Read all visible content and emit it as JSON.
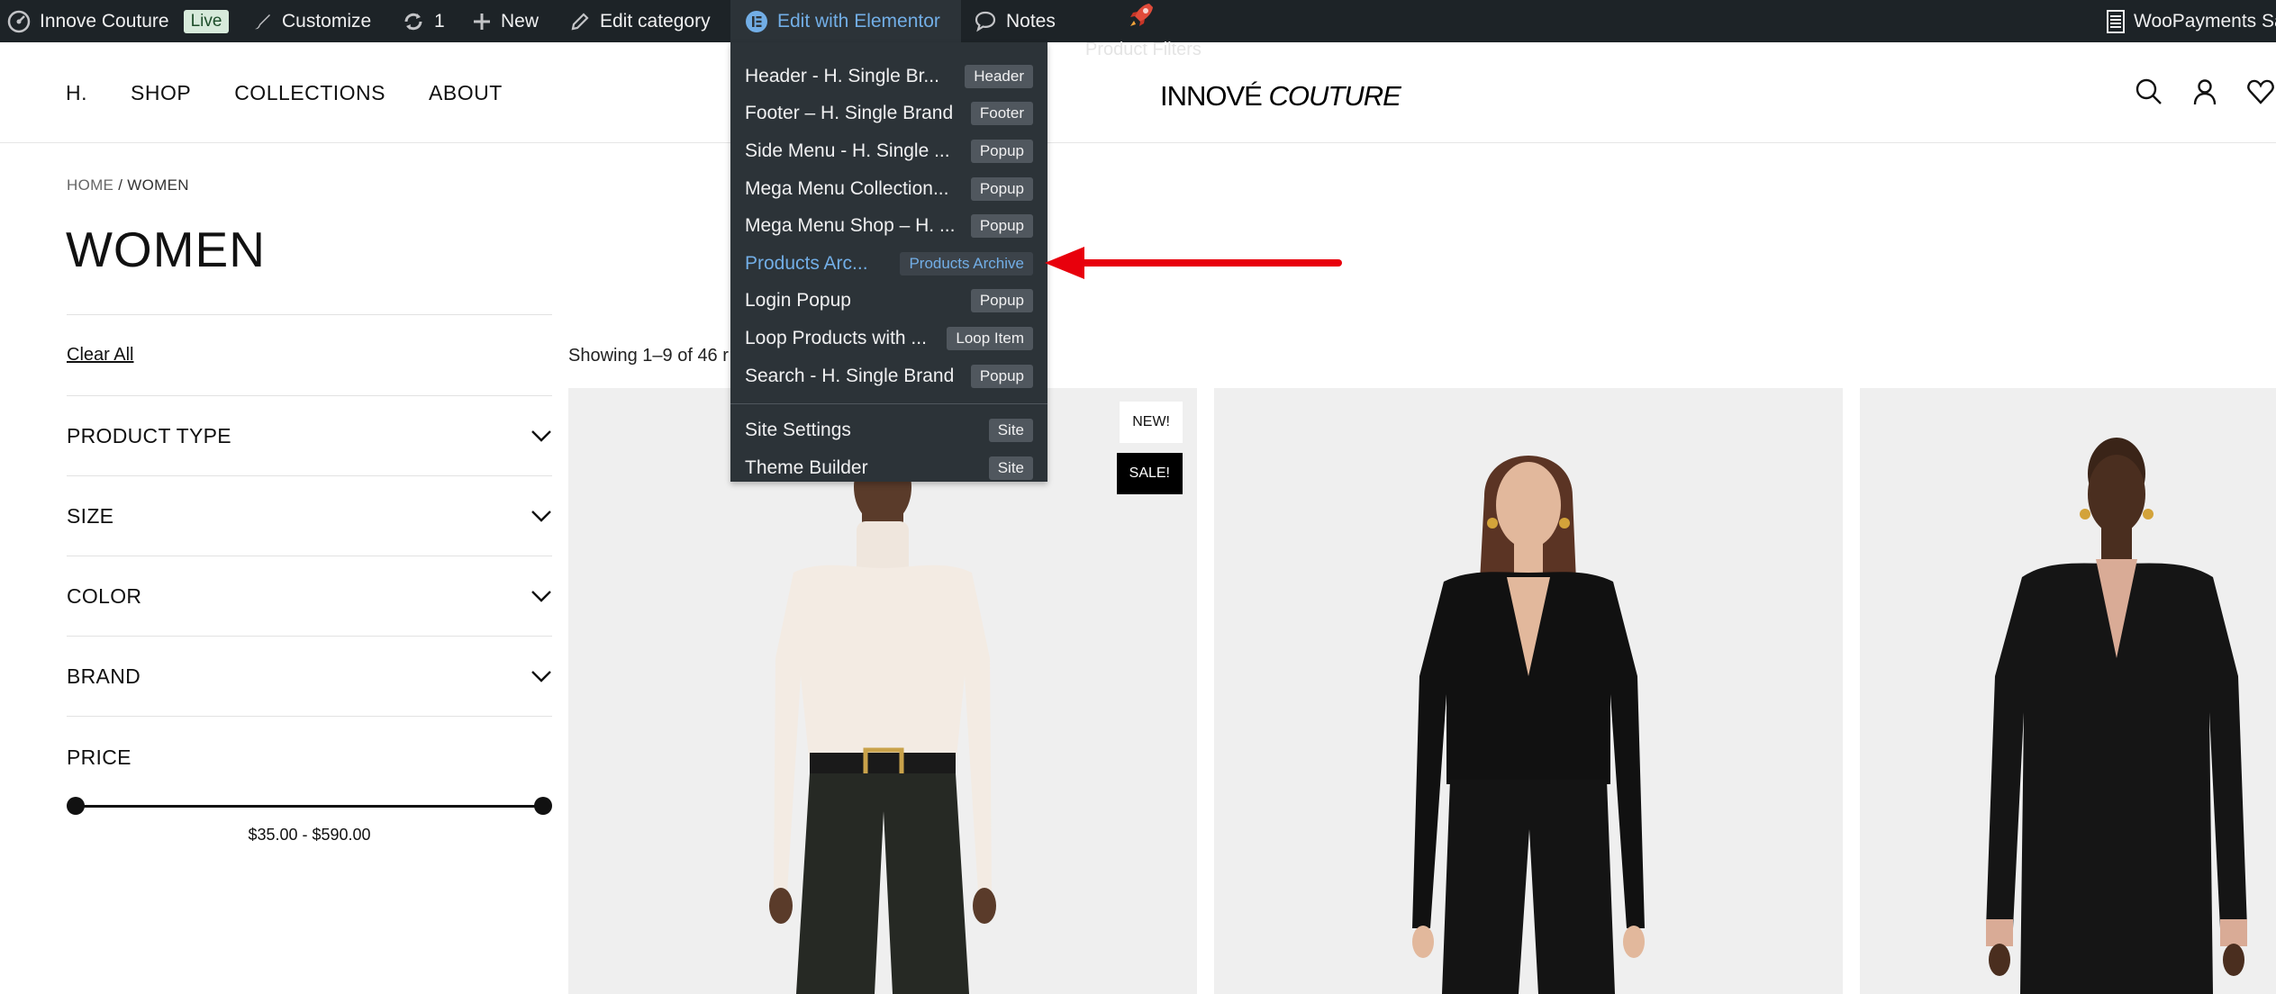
{
  "admin_bar": {
    "site_name": "Innove Couture",
    "live_badge": "Live",
    "customize": "Customize",
    "updates_count": "1",
    "new": "New",
    "edit_category": "Edit category",
    "edit_with_elementor": "Edit with Elementor",
    "notes": "Notes",
    "woopayments": "WooPayments Sa",
    "faint_label": "Product Filters"
  },
  "elementor_menu": {
    "items": [
      {
        "label": "Header - H. Single Br...",
        "tag": "Header"
      },
      {
        "label": "Footer – H. Single Brand",
        "tag": "Footer"
      },
      {
        "label": "Side Menu - H. Single ...",
        "tag": "Popup"
      },
      {
        "label": "Mega Menu Collection...",
        "tag": "Popup"
      },
      {
        "label": "Mega Menu Shop – H. ...",
        "tag": "Popup"
      },
      {
        "label": "Products Arc...",
        "tag": "Products Archive"
      },
      {
        "label": "Login Popup",
        "tag": "Popup"
      },
      {
        "label": "Loop Products with ...",
        "tag": "Loop Item"
      },
      {
        "label": "Search - H. Single Brand",
        "tag": "Popup"
      }
    ],
    "bottom_items": [
      {
        "label": "Site Settings",
        "tag": "Site"
      },
      {
        "label": "Theme Builder",
        "tag": "Site"
      }
    ]
  },
  "header": {
    "nav": [
      "H.",
      "SHOP",
      "COLLECTIONS",
      "ABOUT"
    ],
    "logo_part1": "INNOVÉ",
    "logo_part2": "COUTURE"
  },
  "breadcrumb": {
    "home": "HOME",
    "separator": " / ",
    "current": "WOMEN"
  },
  "page_title": "WOMEN",
  "filters": {
    "clear_all": "Clear All",
    "groups": [
      "PRODUCT TYPE",
      "SIZE",
      "COLOR",
      "BRAND"
    ],
    "price_title": "PRICE",
    "price_range": "$35.00 - $590.00"
  },
  "results": {
    "count_text": "Showing 1–9 of 46 r"
  },
  "badges": {
    "new": "NEW!",
    "sale": "SALE!"
  },
  "colors": {
    "admin_bar_bg": "#1d2327",
    "dropdown_bg": "#2c3338",
    "elementor_link": "#72aee6",
    "arrow": "#e8000c"
  }
}
